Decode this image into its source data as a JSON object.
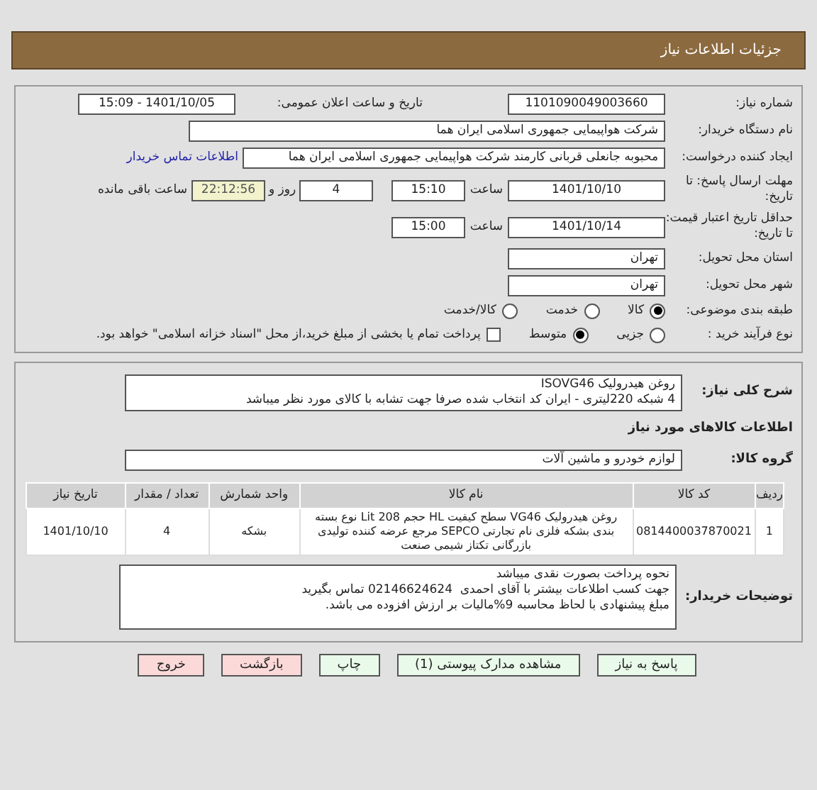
{
  "header": {
    "title": "جزئیات اطلاعات نیاز"
  },
  "need_number": {
    "label": "شماره نیاز:",
    "value": "1101090049003660"
  },
  "announce": {
    "label": "تاریخ و ساعت اعلان عمومی:",
    "value": "1401/10/05 - 15:09"
  },
  "buyer": {
    "label": "نام دستگاه خریدار:",
    "value": "شرکت هواپیمایی جمهوری اسلامی ایران هما"
  },
  "requester": {
    "label": "ایجاد کننده درخواست:",
    "value": "محبوبه جانعلی قربانی کارمند شرکت هواپیمایی جمهوری اسلامی ایران هما",
    "link": "اطلاعات تماس خریدار"
  },
  "deadline": {
    "label": "مهلت ارسال پاسخ: تا تاریخ:",
    "date": "1401/10/10",
    "time_label": "ساعت",
    "time": "15:10",
    "days": "4",
    "days_label": "روز و",
    "remaining": "22:12:56",
    "remaining_label": "ساعت باقی مانده"
  },
  "validity": {
    "label": "حداقل تاریخ اعتبار قیمت: تا تاریخ:",
    "date": "1401/10/14",
    "time_label": "ساعت",
    "time": "15:00"
  },
  "province": {
    "label": "استان محل تحویل:",
    "value": "تهران"
  },
  "city": {
    "label": "شهر محل تحویل:",
    "value": "تهران"
  },
  "category": {
    "label": "طبقه بندی موضوعی:",
    "options": [
      {
        "label": "کالا",
        "selected": true
      },
      {
        "label": "خدمت",
        "selected": false
      },
      {
        "label": "کالا/خدمت",
        "selected": false
      }
    ]
  },
  "process": {
    "label": "نوع فرآیند خرید :",
    "options": [
      {
        "label": "جزیی",
        "selected": false
      },
      {
        "label": "متوسط",
        "selected": true
      }
    ],
    "payment_checkbox": {
      "checked": false,
      "label": "پرداخت تمام یا بخشی از مبلغ خرید،از محل \"اسناد خزانه اسلامی\" خواهد بود."
    }
  },
  "description": {
    "label": "شرح کلی نیاز:",
    "lines": [
      "روغن هیدرولیک ISOVG46",
      "4 شبکه 220لیتری - ایران کد انتخاب شده صرفا جهت تشابه با کالای مورد نظر میباشد"
    ]
  },
  "goods_heading": "اطلاعات کالاهای مورد نیاز",
  "goods_group": {
    "label": "گروه کالا:",
    "value": "لوازم خودرو و ماشین آلات"
  },
  "table": {
    "columns": [
      "ردیف",
      "کد کالا",
      "نام کالا",
      "واحد شمارش",
      "تعداد / مقدار",
      "تاریخ نیاز"
    ],
    "rows": [
      [
        "1",
        "0814400037870021",
        "روغن هیدرولیک VG46 سطح کیفیت HL حجم Lit 208 نوع بسته بندی بشکه فلزی نام تجارتی SEPCO مرجع عرضه کننده تولیدی بازرگانی تکتاز شیمی صنعت",
        "بشکه",
        "4",
        "1401/10/10"
      ]
    ]
  },
  "buyer_notes": {
    "label": "توضیحات خریدار:",
    "lines": [
      "نحوه پرداخت بصورت نقدی میباشد",
      "جهت کسب اطلاعات بیشتر با آقای احمدی  02146624624 تماس بگیرید",
      "مبلغ پیشنهادی با لحاظ محاسبه 9%مالیات بر ارزش افزوده می باشد."
    ]
  },
  "buttons": [
    {
      "label": "پاسخ به نیاز",
      "color": "#eafaea"
    },
    {
      "label": "مشاهده مدارک پیوستی (1)",
      "color": "#eafaea"
    },
    {
      "label": "چاپ",
      "color": "#eafaea"
    },
    {
      "label": "بازگشت",
      "color": "#fcd9d9"
    },
    {
      "label": "خروج",
      "color": "#fcd9d9"
    }
  ]
}
